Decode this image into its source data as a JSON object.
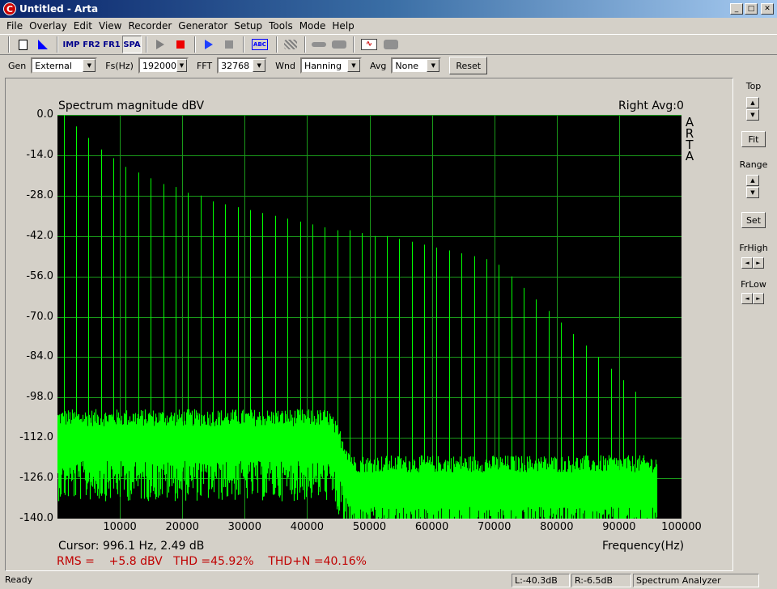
{
  "window": {
    "title": "Untitled - Arta",
    "icon_letter": "C"
  },
  "menu": [
    "File",
    "Overlay",
    "Edit",
    "View",
    "Recorder",
    "Generator",
    "Setup",
    "Tools",
    "Mode",
    "Help"
  ],
  "toolbar": {
    "imp": "IMP",
    "fr2": "FR2",
    "fr1": "FR1",
    "spa": "SPA",
    "abc": "ABC"
  },
  "settings": {
    "gen_label": "Gen",
    "gen_value": "External",
    "fs_label": "Fs(Hz)",
    "fs_value": "192000",
    "fft_label": "FFT",
    "fft_value": "32768",
    "wnd_label": "Wnd",
    "wnd_value": "Hanning",
    "avg_label": "Avg",
    "avg_value": "None",
    "reset_label": "Reset"
  },
  "plot": {
    "title": "Spectrum magnitude dBV",
    "channel_info": "Right  Avg:0",
    "logo": [
      "A",
      "R",
      "T",
      "A"
    ],
    "x_axis_label": "Frequency(Hz)",
    "cursor": "Cursor:   996.1 Hz, 2.49 dB",
    "measurements": "RMS =    +5.8 dBV   THD =45.92%    THD+N =40.16%"
  },
  "side": {
    "top_label": "Top",
    "fit_label": "Fit",
    "range_label": "Range",
    "set_label": "Set",
    "frhigh_label": "FrHigh",
    "frlow_label": "FrLow"
  },
  "status": {
    "ready": "Ready",
    "left_level": "L:-40.3dB",
    "right_level": "R:-6.5dB",
    "mode": "Spectrum Analyzer"
  },
  "colors": {
    "plot_bg": "#000000",
    "grid": "#1a9a1a",
    "trace": "#00ff00",
    "measure_text": "#c00000"
  },
  "chart_data": {
    "type": "line",
    "title": "Spectrum magnitude dBV",
    "xlabel": "Frequency(Hz)",
    "ylabel": "",
    "xlim": [
      0,
      100000
    ],
    "ylim": [
      -140,
      0
    ],
    "x_ticks": [
      "10000",
      "20000",
      "30000",
      "40000",
      "50000",
      "60000",
      "70000",
      "80000",
      "90000",
      "100000"
    ],
    "y_ticks": [
      "0.0",
      "-14.0",
      "-28.0",
      "-42.0",
      "-56.0",
      "-70.0",
      "-84.0",
      "-98.0",
      "-112.0",
      "-126.0",
      "-140.0"
    ],
    "grid": true,
    "fundamental_hz": 996.1,
    "harmonic_peaks_db": [
      2.49,
      -4,
      -8,
      -12,
      -15,
      -18,
      -20,
      -22,
      -24,
      -25,
      -27,
      -28,
      -30,
      -31,
      -32,
      -33,
      -34,
      -35,
      -36,
      -37,
      -38,
      -39,
      -40,
      -40,
      -41,
      -42,
      -42,
      -43,
      -44,
      -45,
      -46,
      -47,
      -48,
      -49,
      -50,
      -52,
      -56,
      -60,
      -64,
      -68,
      -72,
      -76,
      -80,
      -84,
      -88,
      -92,
      -96
    ],
    "noise_floor_db": [
      {
        "f_to": 45000,
        "level": -112
      },
      {
        "f_to": 96000,
        "level": -128
      }
    ],
    "data_end_hz": 96000
  }
}
